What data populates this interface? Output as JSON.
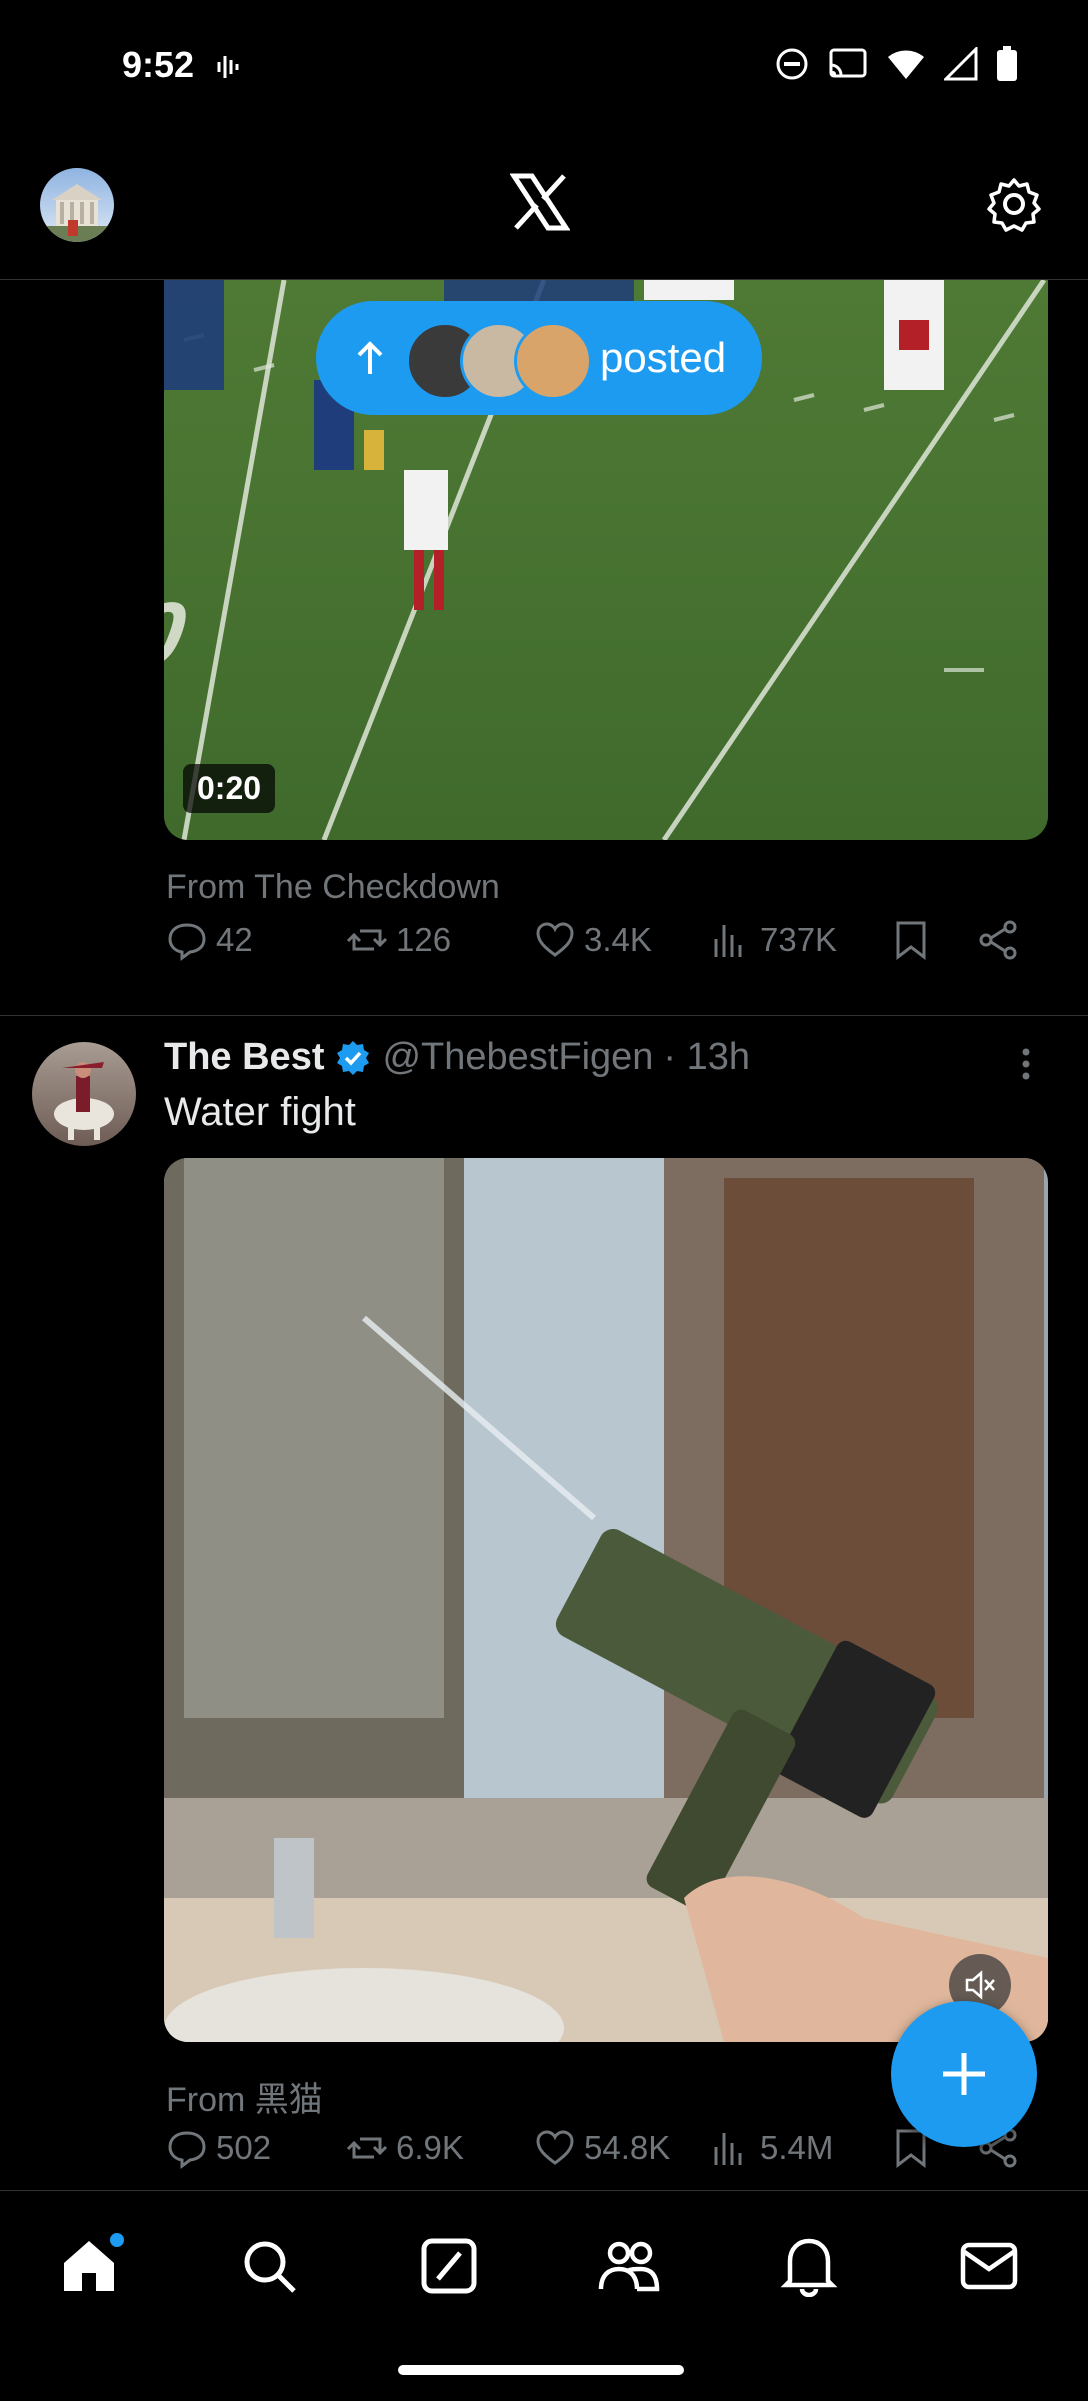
{
  "status_bar": {
    "time": "9:52"
  },
  "header": {
    "logo_icon": "x-logo-icon",
    "settings_icon": "gear-icon"
  },
  "new_posts_pill": {
    "label": "posted",
    "arrow_icon": "arrow-up-icon"
  },
  "post1": {
    "duration": "0:20",
    "from_label": "From The Checkdown",
    "stats": {
      "replies": "42",
      "reposts": "126",
      "likes": "3.4K",
      "views": "737K"
    }
  },
  "post2": {
    "name": "The Best",
    "handle": "@ThebestFigen",
    "time": "· 13h",
    "text": "Water fight",
    "from_label": "From 黑猫",
    "stats": {
      "replies": "502",
      "reposts": "6.9K",
      "likes": "54.8K",
      "views": "5.4M"
    }
  },
  "fab": {
    "icon": "plus-icon"
  },
  "colors": {
    "accent": "#1d9bf0",
    "background": "#000000",
    "muted": "#71767b"
  }
}
